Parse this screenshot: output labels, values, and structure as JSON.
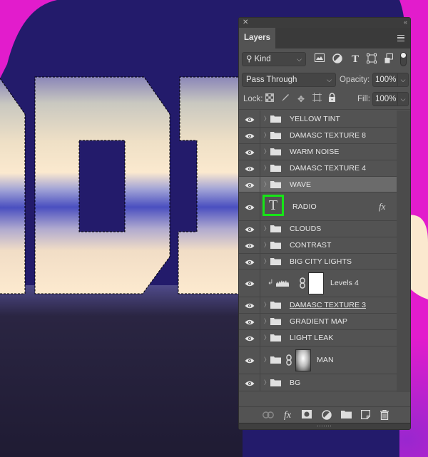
{
  "panel": {
    "close_glyph": "✕",
    "collapse_glyph": "‹‹",
    "tab_label": "Layers",
    "filter": {
      "kind_label": "Kind",
      "icons": [
        "image-filter-icon",
        "adjustment-filter-icon",
        "type-filter-icon",
        "shape-filter-icon",
        "smart-object-filter-icon"
      ]
    },
    "blend_mode": "Pass Through",
    "opacity_label": "Opacity:",
    "opacity_value": "100%",
    "lock_label": "Lock:",
    "fill_label": "Fill:",
    "fill_value": "100%"
  },
  "layers": [
    {
      "name": "YELLOW TINT",
      "type": "group",
      "visible": true,
      "selected": false
    },
    {
      "name": "DAMASC TEXTURE 8",
      "type": "group",
      "visible": true,
      "selected": false
    },
    {
      "name": "WARM NOISE",
      "type": "group",
      "visible": true,
      "selected": false
    },
    {
      "name": "DAMASC TEXTURE 4",
      "type": "group",
      "visible": true,
      "selected": false
    },
    {
      "name": "WAVE",
      "type": "group",
      "visible": true,
      "selected": true
    },
    {
      "name": "RADIO",
      "type": "text",
      "visible": true,
      "selected": false,
      "has_fx": true,
      "thumb_glyph": "T",
      "highlight_color": "#16e616"
    },
    {
      "name": "CLOUDS",
      "type": "group",
      "visible": true,
      "selected": false
    },
    {
      "name": "CONTRAST",
      "type": "group",
      "visible": true,
      "selected": false
    },
    {
      "name": "BIG CITY LIGHTS",
      "type": "group",
      "visible": true,
      "selected": false
    },
    {
      "name": "Levels 4",
      "type": "adjustment",
      "visible": true,
      "selected": false,
      "clipped": true
    },
    {
      "name": "DAMASC TEXTURE 3",
      "type": "group",
      "visible": true,
      "selected": false
    },
    {
      "name": "GRADIENT MAP",
      "type": "group",
      "visible": true,
      "selected": false
    },
    {
      "name": "LIGHT LEAK",
      "type": "group",
      "visible": true,
      "selected": false
    },
    {
      "name": "MAN",
      "type": "group-masked",
      "visible": true,
      "selected": false
    },
    {
      "name": "BG",
      "type": "group",
      "visible": true,
      "selected": false
    }
  ],
  "fx_glyph": "fx",
  "footer": {
    "buttons": [
      "link-layers",
      "add-layer-style",
      "add-mask",
      "new-adjustment-layer",
      "new-group",
      "new-layer",
      "delete-layer"
    ]
  },
  "colors": {
    "background_magenta": "#e21ccc",
    "silhouette_purple": "#231b6b",
    "letter_cream": "#fbe9cf",
    "wave_blue": "#4a4fc0",
    "panel_gray": "#535353",
    "selection_highlight": "#16e616"
  }
}
